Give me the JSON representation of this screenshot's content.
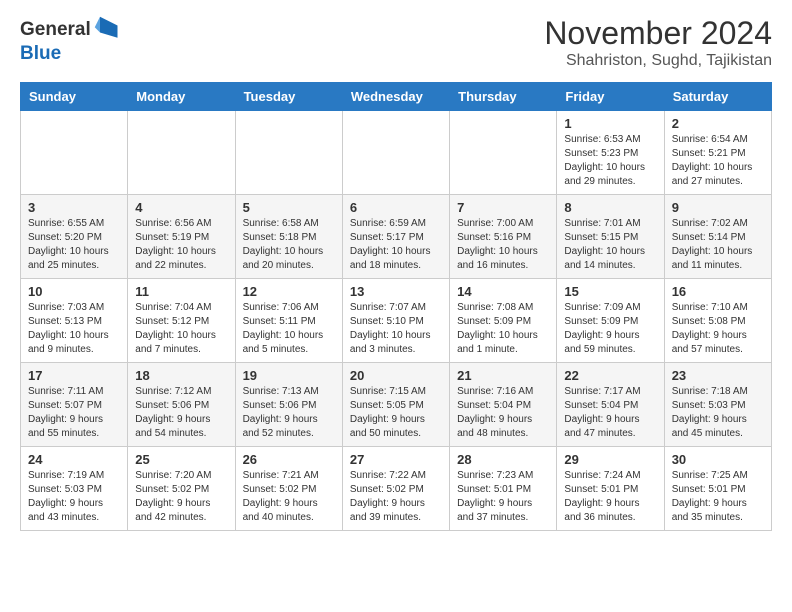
{
  "logo": {
    "general": "General",
    "blue": "Blue"
  },
  "title": "November 2024",
  "location": "Shahriston, Sughd, Tajikistan",
  "days_header": [
    "Sunday",
    "Monday",
    "Tuesday",
    "Wednesday",
    "Thursday",
    "Friday",
    "Saturday"
  ],
  "weeks": [
    [
      {
        "day": "",
        "info": ""
      },
      {
        "day": "",
        "info": ""
      },
      {
        "day": "",
        "info": ""
      },
      {
        "day": "",
        "info": ""
      },
      {
        "day": "",
        "info": ""
      },
      {
        "day": "1",
        "info": "Sunrise: 6:53 AM\nSunset: 5:23 PM\nDaylight: 10 hours and 29 minutes."
      },
      {
        "day": "2",
        "info": "Sunrise: 6:54 AM\nSunset: 5:21 PM\nDaylight: 10 hours and 27 minutes."
      }
    ],
    [
      {
        "day": "3",
        "info": "Sunrise: 6:55 AM\nSunset: 5:20 PM\nDaylight: 10 hours and 25 minutes."
      },
      {
        "day": "4",
        "info": "Sunrise: 6:56 AM\nSunset: 5:19 PM\nDaylight: 10 hours and 22 minutes."
      },
      {
        "day": "5",
        "info": "Sunrise: 6:58 AM\nSunset: 5:18 PM\nDaylight: 10 hours and 20 minutes."
      },
      {
        "day": "6",
        "info": "Sunrise: 6:59 AM\nSunset: 5:17 PM\nDaylight: 10 hours and 18 minutes."
      },
      {
        "day": "7",
        "info": "Sunrise: 7:00 AM\nSunset: 5:16 PM\nDaylight: 10 hours and 16 minutes."
      },
      {
        "day": "8",
        "info": "Sunrise: 7:01 AM\nSunset: 5:15 PM\nDaylight: 10 hours and 14 minutes."
      },
      {
        "day": "9",
        "info": "Sunrise: 7:02 AM\nSunset: 5:14 PM\nDaylight: 10 hours and 11 minutes."
      }
    ],
    [
      {
        "day": "10",
        "info": "Sunrise: 7:03 AM\nSunset: 5:13 PM\nDaylight: 10 hours and 9 minutes."
      },
      {
        "day": "11",
        "info": "Sunrise: 7:04 AM\nSunset: 5:12 PM\nDaylight: 10 hours and 7 minutes."
      },
      {
        "day": "12",
        "info": "Sunrise: 7:06 AM\nSunset: 5:11 PM\nDaylight: 10 hours and 5 minutes."
      },
      {
        "day": "13",
        "info": "Sunrise: 7:07 AM\nSunset: 5:10 PM\nDaylight: 10 hours and 3 minutes."
      },
      {
        "day": "14",
        "info": "Sunrise: 7:08 AM\nSunset: 5:09 PM\nDaylight: 10 hours and 1 minute."
      },
      {
        "day": "15",
        "info": "Sunrise: 7:09 AM\nSunset: 5:09 PM\nDaylight: 9 hours and 59 minutes."
      },
      {
        "day": "16",
        "info": "Sunrise: 7:10 AM\nSunset: 5:08 PM\nDaylight: 9 hours and 57 minutes."
      }
    ],
    [
      {
        "day": "17",
        "info": "Sunrise: 7:11 AM\nSunset: 5:07 PM\nDaylight: 9 hours and 55 minutes."
      },
      {
        "day": "18",
        "info": "Sunrise: 7:12 AM\nSunset: 5:06 PM\nDaylight: 9 hours and 54 minutes."
      },
      {
        "day": "19",
        "info": "Sunrise: 7:13 AM\nSunset: 5:06 PM\nDaylight: 9 hours and 52 minutes."
      },
      {
        "day": "20",
        "info": "Sunrise: 7:15 AM\nSunset: 5:05 PM\nDaylight: 9 hours and 50 minutes."
      },
      {
        "day": "21",
        "info": "Sunrise: 7:16 AM\nSunset: 5:04 PM\nDaylight: 9 hours and 48 minutes."
      },
      {
        "day": "22",
        "info": "Sunrise: 7:17 AM\nSunset: 5:04 PM\nDaylight: 9 hours and 47 minutes."
      },
      {
        "day": "23",
        "info": "Sunrise: 7:18 AM\nSunset: 5:03 PM\nDaylight: 9 hours and 45 minutes."
      }
    ],
    [
      {
        "day": "24",
        "info": "Sunrise: 7:19 AM\nSunset: 5:03 PM\nDaylight: 9 hours and 43 minutes."
      },
      {
        "day": "25",
        "info": "Sunrise: 7:20 AM\nSunset: 5:02 PM\nDaylight: 9 hours and 42 minutes."
      },
      {
        "day": "26",
        "info": "Sunrise: 7:21 AM\nSunset: 5:02 PM\nDaylight: 9 hours and 40 minutes."
      },
      {
        "day": "27",
        "info": "Sunrise: 7:22 AM\nSunset: 5:02 PM\nDaylight: 9 hours and 39 minutes."
      },
      {
        "day": "28",
        "info": "Sunrise: 7:23 AM\nSunset: 5:01 PM\nDaylight: 9 hours and 37 minutes."
      },
      {
        "day": "29",
        "info": "Sunrise: 7:24 AM\nSunset: 5:01 PM\nDaylight: 9 hours and 36 minutes."
      },
      {
        "day": "30",
        "info": "Sunrise: 7:25 AM\nSunset: 5:01 PM\nDaylight: 9 hours and 35 minutes."
      }
    ]
  ]
}
